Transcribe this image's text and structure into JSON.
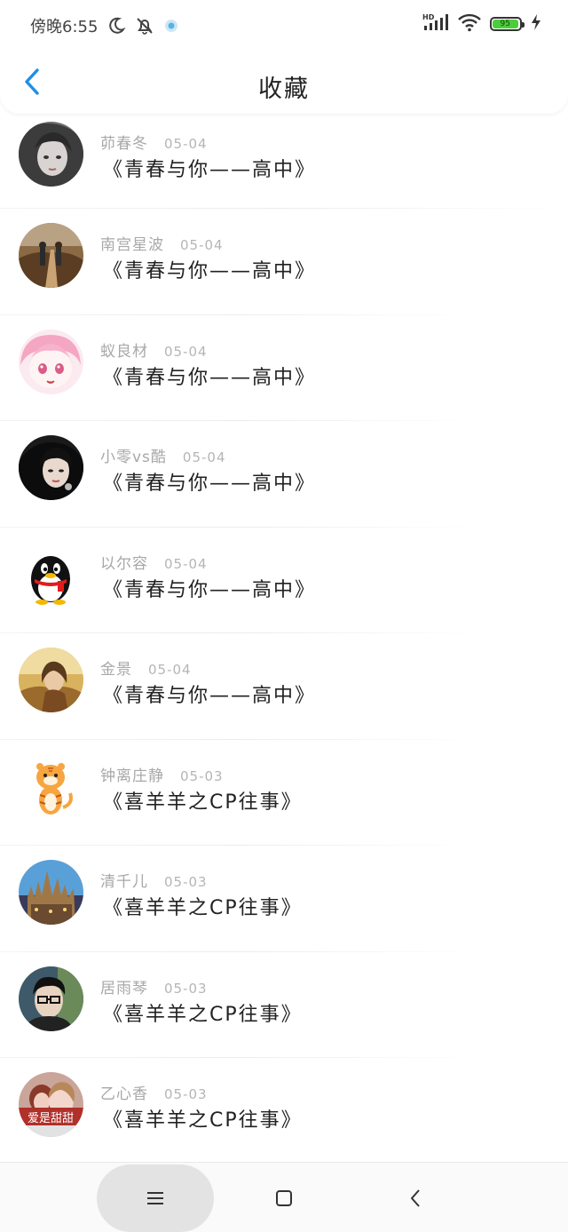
{
  "status_bar": {
    "time": "傍晚6:55",
    "battery_level": "95",
    "network_label": "HD"
  },
  "header": {
    "title": "收藏",
    "back_icon": "chevron-left-icon"
  },
  "favorites": [
    {
      "name": "茆春冬",
      "date": "05-04",
      "book": "《青春与你——高中》",
      "avatar": "portrait-girl-bw"
    },
    {
      "name": "南宫星波",
      "date": "05-04",
      "book": "《青春与你——高中》",
      "avatar": "couple-path-photo"
    },
    {
      "name": "蚁良材",
      "date": "05-04",
      "book": "《青春与你——高中》",
      "avatar": "anime-pink-hair"
    },
    {
      "name": "小零vs酷",
      "date": "05-04",
      "book": "《青春与你——高中》",
      "avatar": "portrait-girl-dark"
    },
    {
      "name": "以尔容",
      "date": "05-04",
      "book": "《青春与你——高中》",
      "avatar": "qq-penguin"
    },
    {
      "name": "金景",
      "date": "05-04",
      "book": "《青春与你——高中》",
      "avatar": "portrait-autumn"
    },
    {
      "name": "钟离庄静",
      "date": "05-03",
      "book": "《喜羊羊之CP往事》",
      "avatar": "cartoon-tiger"
    },
    {
      "name": "清千儿",
      "date": "05-03",
      "book": "《喜羊羊之CP往事》",
      "avatar": "castle-photo"
    },
    {
      "name": "居雨琴",
      "date": "05-03",
      "book": "《喜羊羊之CP往事》",
      "avatar": "boy-glasses"
    },
    {
      "name": "乙心香",
      "date": "05-03",
      "book": "《喜羊羊之CP往事》",
      "avatar": "couple-photo-caption",
      "avatar_caption": "爱是甜甜"
    }
  ],
  "nav_bar": {
    "menu_icon": "menu-icon",
    "home_icon": "square-home-icon",
    "back_icon": "triangle-back-icon"
  },
  "colors": {
    "accent": "#1e8fe6",
    "title_text": "#222222",
    "meta_text": "#a8a8a8",
    "battery": "#4ccd3c"
  }
}
